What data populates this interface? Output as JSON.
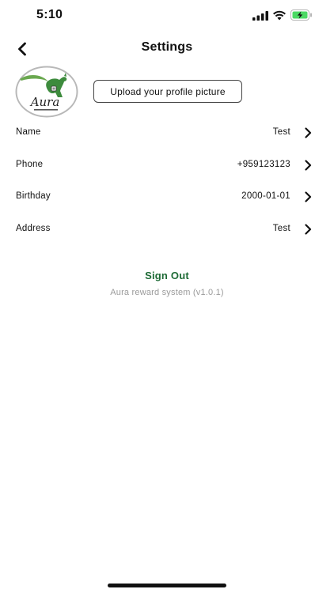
{
  "status_bar": {
    "time": "5:10",
    "icons": [
      "cellular-signal-icon",
      "wifi-icon",
      "battery-charging-icon"
    ],
    "battery_color": "#4cd964"
  },
  "header": {
    "title": "Settings",
    "back_icon": "chevron-left-icon"
  },
  "profile": {
    "avatar_logo_text": "Aura",
    "upload_label": "Upload your profile picture"
  },
  "settings": {
    "rows": [
      {
        "label": "Name",
        "value": "Test"
      },
      {
        "label": "Phone",
        "value": "+959123123"
      },
      {
        "label": "Birthday",
        "value": "2000-01-01"
      },
      {
        "label": "Address",
        "value": "Test"
      }
    ]
  },
  "footer": {
    "sign_out_label": "Sign Out",
    "version_text": "Aura reward system (v1.0.1)"
  },
  "colors": {
    "accent": "#1e6b36",
    "secondary_text": "#9a9a9a"
  }
}
